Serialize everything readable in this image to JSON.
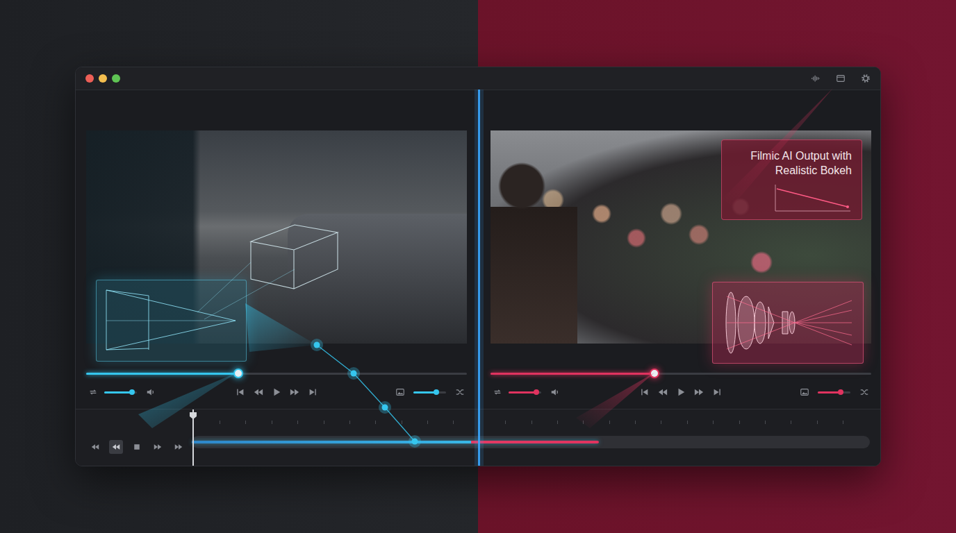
{
  "panes": [
    {
      "kind": "wireframe",
      "color": "#35c6ee",
      "scrub": {
        "level": 0.4
      },
      "volume": {
        "level": 0.85
      },
      "image_size": {
        "level": 0.7
      }
    },
    {
      "kind": "bokeh",
      "color": "#e0335f",
      "callout": {
        "text": "Filmic AI Output with Realistic Bokeh"
      },
      "scrub": {
        "level": 0.43
      },
      "volume": {
        "level": 0.85
      },
      "image_size": {
        "level": 0.7
      }
    }
  ],
  "timeline": {
    "playhead": {
      "level": 0.0
    },
    "progress": {
      "level": 0.6
    },
    "transport": [
      {
        "kind": "rewind",
        "selected": false
      },
      {
        "kind": "step-back",
        "selected": true
      },
      {
        "kind": "stop",
        "selected": false
      },
      {
        "kind": "step-forward",
        "selected": false
      },
      {
        "kind": "fast-forward",
        "selected": false
      }
    ]
  }
}
